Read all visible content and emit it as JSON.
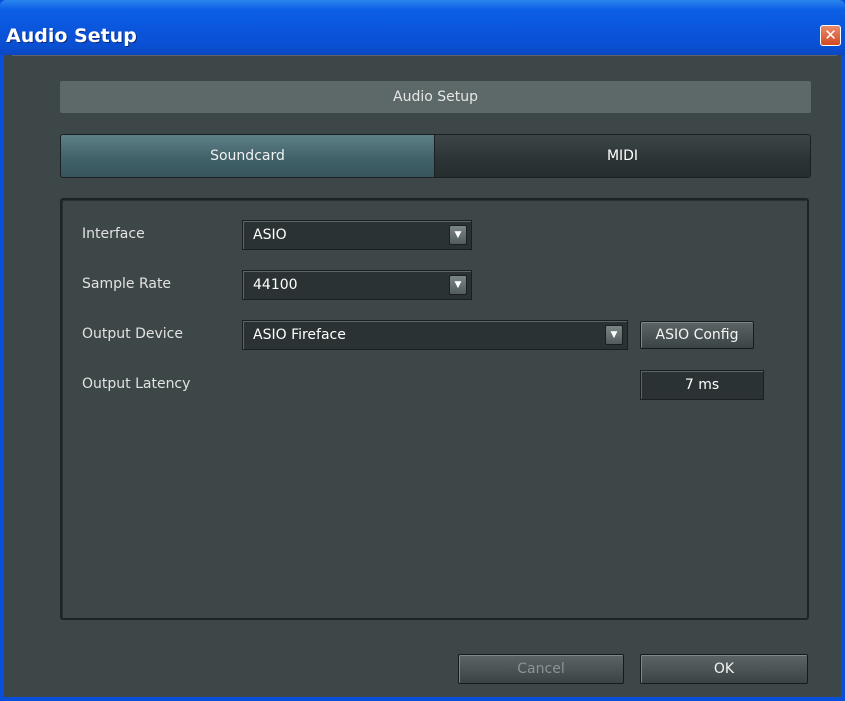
{
  "window": {
    "title": "Audio Setup",
    "close_symbol": "✕"
  },
  "header": {
    "title": "Audio Setup"
  },
  "tabs": [
    {
      "label": "Soundcard",
      "active": true
    },
    {
      "label": "MIDI",
      "active": false
    }
  ],
  "fields": {
    "interface": {
      "label": "Interface",
      "value": "ASIO"
    },
    "sample_rate": {
      "label": "Sample Rate",
      "value": "44100"
    },
    "output_device": {
      "label": "Output Device",
      "value": "ASIO Fireface"
    },
    "output_latency": {
      "label": "Output Latency",
      "value": "7 ms"
    }
  },
  "buttons": {
    "asio_config": "ASIO Config",
    "cancel": "Cancel",
    "ok": "OK"
  },
  "icons": {
    "dropdown": "chevron-down-icon",
    "close": "close-icon"
  },
  "colors": {
    "titlebar": "#0a55dc",
    "background": "#3e4748",
    "active_tab": "#42626a"
  }
}
